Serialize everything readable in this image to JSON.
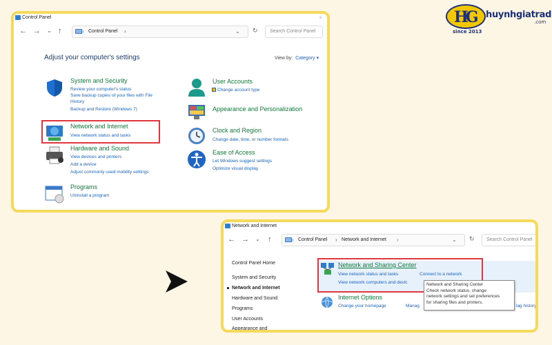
{
  "logo": {
    "brand": "huynhgiatrading",
    "domain": ".com",
    "since": "since 2013",
    "mark": "HG"
  },
  "window1": {
    "title": "Control Panel",
    "breadcrumb": [
      "Control Panel"
    ],
    "search_placeholder": "Search Control Panel",
    "heading": "Adjust your computer's settings",
    "view_by_label": "View by:",
    "view_by_value": "Category",
    "categories_left": [
      {
        "title": "System and Security",
        "links": [
          "Review your computer's status",
          "Save backup copies of your files with File",
          "History",
          "Backup and Restore (Windows 7)"
        ],
        "icon": "shield-icon"
      },
      {
        "title": "Network and Internet",
        "links": [
          "View network status and tasks"
        ],
        "icon": "network-icon",
        "highlighted": true
      },
      {
        "title": "Hardware and Sound",
        "links": [
          "View devices and printers",
          "Add a device",
          "Adjust commonly used mobility settings"
        ],
        "icon": "printer-icon"
      },
      {
        "title": "Programs",
        "links": [
          "Uninstall a program"
        ],
        "icon": "programs-icon"
      }
    ],
    "categories_right": [
      {
        "title": "User Accounts",
        "links": [
          "Change account type"
        ],
        "icon": "user-icon"
      },
      {
        "title": "Appearance and Personalization",
        "links": [],
        "icon": "appearance-icon"
      },
      {
        "title": "Clock and Region",
        "links": [
          "Change date, time, or number formats"
        ],
        "icon": "clock-icon"
      },
      {
        "title": "Ease of Access",
        "links": [
          "Let Windows suggest settings",
          "Optimize visual display"
        ],
        "icon": "accessibility-icon"
      }
    ]
  },
  "window2": {
    "title": "Network and Internet",
    "breadcrumb": [
      "Control Panel",
      "Network and Internet"
    ],
    "search_placeholder": "Search Control Panel",
    "sidebar": [
      "Control Panel Home",
      "System and Security",
      "Network and Internet",
      "Hardware and Sound",
      "Programs",
      "User Accounts",
      "Appearance and"
    ],
    "sidebar_active": "Network and Internet",
    "items": [
      {
        "title": "Network and Sharing Center",
        "links": [
          "View network status and tasks",
          "Connect to a network",
          "View network computers and devic"
        ],
        "highlighted": true
      },
      {
        "title": "Internet Options",
        "links": [
          "Change your homepage",
          "Manag"
        ],
        "tail": "lag history"
      }
    ],
    "tooltip": [
      "Network and Sharing Center",
      "Check network status, change",
      "network settings and set preferences",
      "for sharing files and printers."
    ]
  },
  "colors": {
    "accent_green": "#0f7a38",
    "link_blue": "#1a63c2",
    "highlight_red": "#e0343f",
    "frame_yellow": "#f4d95a",
    "background": "#fdf6e4"
  }
}
